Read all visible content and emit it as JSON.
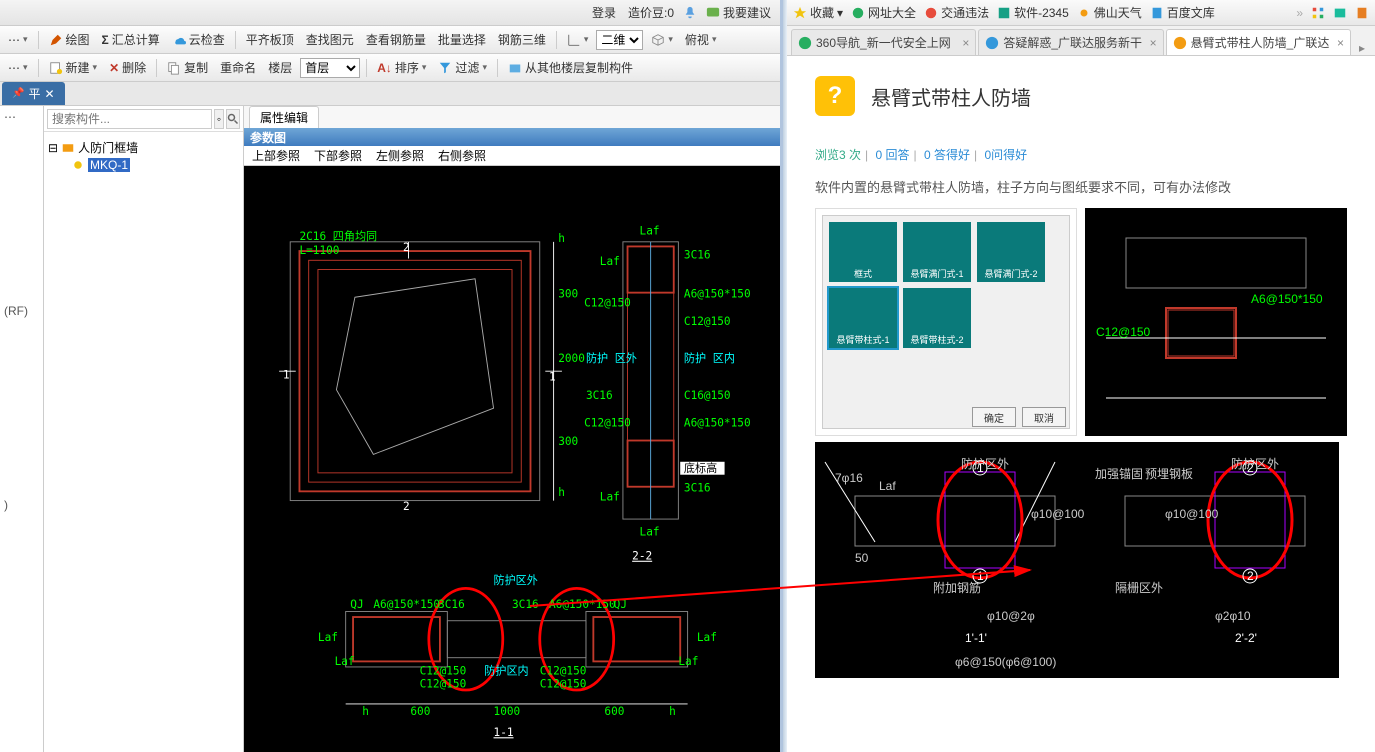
{
  "left": {
    "top": {
      "login": "登录",
      "coin": "造价豆:0",
      "suggest": "我要建议"
    },
    "tb1": {
      "draw": "绘图",
      "sum": "汇总计算",
      "cloud": "云检查",
      "flat": "平齐板顶",
      "find": "查找图元",
      "rebar": "查看钢筋量",
      "batch": "批量选择",
      "tri": "钢筋三维",
      "view": "二维",
      "over": "俯视"
    },
    "tb2": {
      "new": "新建",
      "del": "删除",
      "copy": "复制",
      "rename": "重命名",
      "floor": "楼层",
      "floor_sel": "首层",
      "sort": "排序",
      "filter": "过滤",
      "copyfrom": "从其他楼层复制构件"
    },
    "tab": "平",
    "search_ph": "搜索构件...",
    "tree": {
      "root": "人防门框墙",
      "child": "MKQ-1"
    },
    "rf": "(RF)",
    "prop_tab": "属性编辑",
    "param": "参数图",
    "refs": [
      "上部参照",
      "下部参照",
      "左侧参照",
      "右侧参照"
    ],
    "cad": {
      "t1": "2C16 四角均同",
      "L": "L=1100",
      "n2": "2",
      "n1": "1",
      "d300": "300",
      "d2000": "2000",
      "h": "h",
      "Laf": "Laf",
      "out": "防护\n区外",
      "in": "防护\n区内",
      "r1": "3C16",
      "r2": "A6@150*150",
      "r3": "C12@150",
      "r4": "C16@150",
      "floor": "底标高",
      "sec22": "2-2",
      "sec11": "1-1",
      "out2": "防护区外",
      "in2": "防护区内",
      "qj": "QJ",
      "a6": "A6@150*150",
      "c12": "C12@150",
      "d600": "600",
      "d1000": "1000"
    }
  },
  "right": {
    "fav": {
      "collect": "收藏",
      "wz": "网址大全",
      "traffic": "交通违法",
      "soft": "软件-2345",
      "weather": "佛山天气",
      "baidu": "百度文库"
    },
    "tabs": [
      {
        "t": "360导航_新一代安全上网"
      },
      {
        "t": "答疑解惑_广联达服务新干"
      },
      {
        "t": "悬臂式带柱人防墙_广联达",
        "active": true
      }
    ],
    "page": {
      "title": "悬臂式带柱人防墙",
      "meta": {
        "views": "浏览3 次",
        "ans": "0 回答",
        "good": "0 答得好",
        "ask": "0问得好"
      },
      "desc": "软件内置的悬臂式带柱人防墙，柱子方向与图纸要求不同，可有办法修改",
      "dialog": {
        "cells": [
          "框式",
          "悬臂满门式-1",
          "悬臂满门式-2",
          "悬臂带柱式-1",
          "悬臂带柱式-2"
        ],
        "ok": "确定",
        "cancel": "取消"
      },
      "wide": {
        "s1": "1'-1'",
        "s2": "2'-2'",
        "zone": "防护区外",
        "note": "φ6@150(φ6@100)"
      }
    }
  }
}
